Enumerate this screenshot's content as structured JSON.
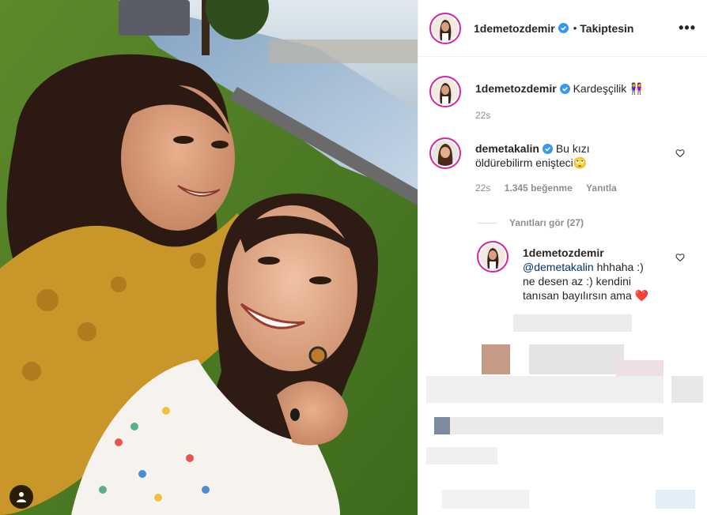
{
  "post": {
    "author": "1demetozdemir",
    "follow_status": "Takiptesin",
    "more_label": "•••"
  },
  "caption": {
    "username": "1demetozdemir",
    "text": "Kardeşçilik 👭",
    "time": "22s"
  },
  "comments": [
    {
      "username": "demetakalin",
      "text_line1": "Bu kızı",
      "text_line2": "öldürebilirm enişteci🙄",
      "time": "22s",
      "likes": "1.345 beğenme",
      "reply_label": "Yanıtla"
    }
  ],
  "replies_toggle": "Yanıtları gör (27)",
  "reply": {
    "username": "1demetozdemir",
    "mention": "@demetakalin",
    "text_line1": "hhhaha :)",
    "text_line2": "ne desen az :) kendini",
    "text_line3": "tanısan bayılırsın ama",
    "emoji": "❤️"
  },
  "colors": {
    "ring": "#d6249f",
    "verified": "#3897f0",
    "meta": "#8e8e8e",
    "link": "#00376b"
  },
  "icons": [
    "verified-badge-icon",
    "heart-icon",
    "user-tag-icon",
    "more-options-icon"
  ]
}
